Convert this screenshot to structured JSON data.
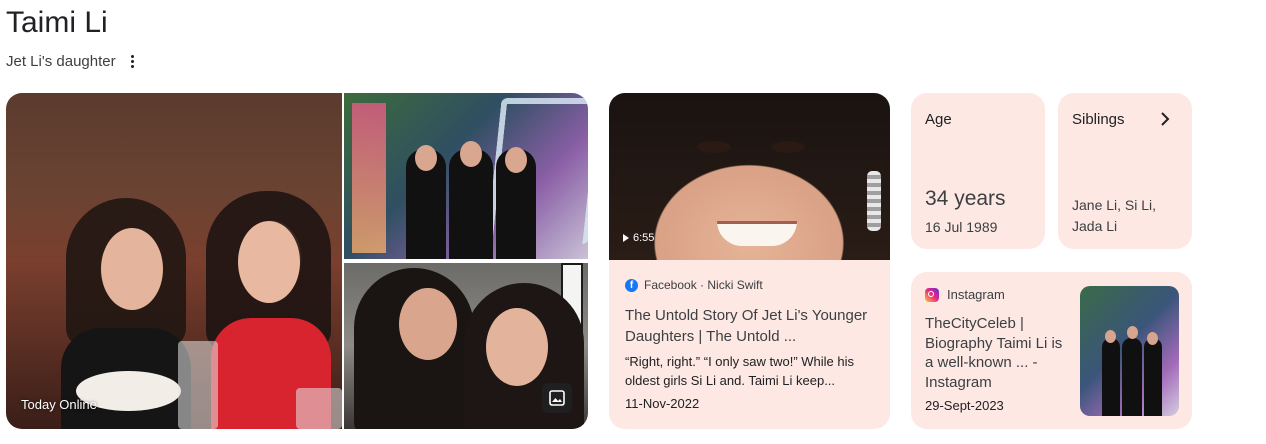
{
  "header": {
    "title": "Taimi Li",
    "subtitle": "Jet Li's daughter"
  },
  "photos": {
    "caption": "Today Online"
  },
  "video_card": {
    "duration": "6:55",
    "source": "Facebook · Nicki Swift",
    "title": "The Untold Story Of Jet Li's Younger Daughters | The Untold ...",
    "snippet": "“Right, right.” “I only saw two!” While his oldest girls Si Li and. Taimi Li keep...",
    "date": "11-Nov-2022"
  },
  "age_card": {
    "label": "Age",
    "value": "34 years",
    "birthdate": "16 Jul 1989"
  },
  "siblings_card": {
    "label": "Siblings",
    "names": "Jane Li, Si Li, Jada Li"
  },
  "instagram_card": {
    "source": "Instagram",
    "text": "TheCityCeleb | Biography Taimi Li is a well-known ... - Instagram",
    "date": "29-Sept-2023"
  },
  "colors": {
    "card_bg": "#fde8e4",
    "text": "#202124"
  },
  "icons": [
    "more-vert-icon",
    "image-icon",
    "play-icon",
    "facebook-icon",
    "chevron-right-icon",
    "instagram-icon"
  ]
}
